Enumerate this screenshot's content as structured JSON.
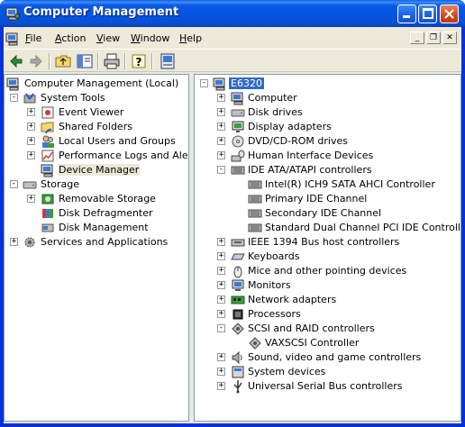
{
  "window": {
    "title": "Computer Management"
  },
  "menu": [
    {
      "label": "File",
      "key": "F",
      "rest": "ile"
    },
    {
      "label": "Action",
      "key": "A",
      "rest": "ction"
    },
    {
      "label": "View",
      "key": "V",
      "rest": "iew"
    },
    {
      "label": "Window",
      "key": "W",
      "rest": "indow"
    },
    {
      "label": "Help",
      "key": "H",
      "rest": "elp"
    }
  ],
  "toolbar": [
    "back-icon",
    "forward-icon",
    "up-folder-icon",
    "show-hide-tree-icon",
    "print-icon",
    "help-icon",
    "properties-icon"
  ],
  "tree": {
    "root": "Computer Management (Local)",
    "system_tools": "System Tools",
    "event_viewer": "Event Viewer",
    "shared_folders": "Shared Folders",
    "local_users": "Local Users and Groups",
    "perf_logs": "Performance Logs and Alerts",
    "device_manager": "Device Manager",
    "storage": "Storage",
    "removable_storage": "Removable Storage",
    "disk_defrag": "Disk Defragmenter",
    "disk_mgmt": "Disk Management",
    "services": "Services and Applications"
  },
  "devices": {
    "root": "E6320",
    "items": [
      {
        "label": "Computer",
        "exp": "+",
        "level": 1,
        "icon": "computer-icon"
      },
      {
        "label": "Disk drives",
        "exp": "+",
        "level": 1,
        "icon": "disk-drive-icon"
      },
      {
        "label": "Display adapters",
        "exp": "+",
        "level": 1,
        "icon": "display-icon"
      },
      {
        "label": "DVD/CD-ROM drives",
        "exp": "+",
        "level": 1,
        "icon": "cdrom-icon"
      },
      {
        "label": "Human Interface Devices",
        "exp": "+",
        "level": 1,
        "icon": "hid-icon"
      },
      {
        "label": "IDE ATA/ATAPI controllers",
        "exp": "-",
        "level": 1,
        "icon": "ide-controller-icon"
      },
      {
        "label": "Intel(R) ICH9 SATA AHCI Controller",
        "exp": "",
        "level": 2,
        "icon": "ide-controller-icon"
      },
      {
        "label": "Primary IDE Channel",
        "exp": "",
        "level": 2,
        "icon": "ide-controller-icon"
      },
      {
        "label": "Secondary IDE Channel",
        "exp": "",
        "level": 2,
        "icon": "ide-controller-icon"
      },
      {
        "label": "Standard Dual Channel PCI IDE Controller",
        "exp": "",
        "level": 2,
        "icon": "ide-controller-icon"
      },
      {
        "label": "IEEE 1394 Bus host controllers",
        "exp": "+",
        "level": 1,
        "icon": "firewire-icon"
      },
      {
        "label": "Keyboards",
        "exp": "+",
        "level": 1,
        "icon": "keyboard-icon"
      },
      {
        "label": "Mice and other pointing devices",
        "exp": "+",
        "level": 1,
        "icon": "mouse-icon"
      },
      {
        "label": "Monitors",
        "exp": "+",
        "level": 1,
        "icon": "monitor-icon"
      },
      {
        "label": "Network adapters",
        "exp": "+",
        "level": 1,
        "icon": "network-adapter-icon"
      },
      {
        "label": "Processors",
        "exp": "+",
        "level": 1,
        "icon": "processor-icon"
      },
      {
        "label": "SCSI and RAID controllers",
        "exp": "-",
        "level": 1,
        "icon": "scsi-icon"
      },
      {
        "label": "VAXSCSI Controller",
        "exp": "",
        "level": 2,
        "icon": "scsi-icon"
      },
      {
        "label": "Sound, video and game controllers",
        "exp": "+",
        "level": 1,
        "icon": "sound-icon"
      },
      {
        "label": "System devices",
        "exp": "+",
        "level": 1,
        "icon": "system-device-icon"
      },
      {
        "label": "Universal Serial Bus controllers",
        "exp": "+",
        "level": 1,
        "icon": "usb-icon"
      }
    ]
  },
  "colors": {
    "titlebar": "#0553e0",
    "selection": "#316ac5",
    "frame": "#ece9d8"
  }
}
